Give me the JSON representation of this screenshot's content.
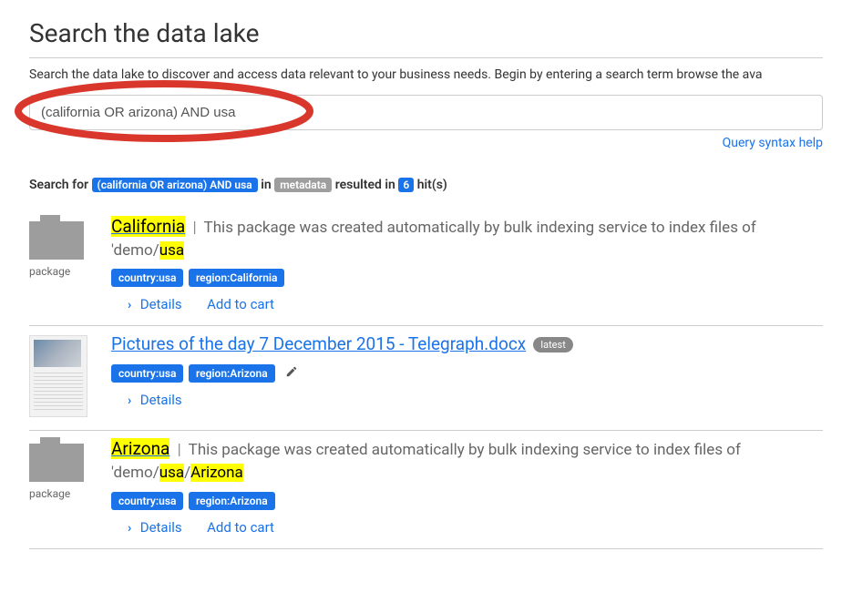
{
  "page": {
    "title": "Search the data lake",
    "subtitle": "Search the data lake to discover and access data relevant to your business needs. Begin by entering a search term browse the ava"
  },
  "search": {
    "value": "(california OR arizona) AND usa",
    "help_label": "Query syntax help"
  },
  "summary": {
    "prefix": "Search for",
    "query": "(california OR arizona) AND usa",
    "in_word": "in",
    "scope": "metadata",
    "result_word": "resulted in",
    "count": "6",
    "suffix": "hit(s)"
  },
  "results": [
    {
      "kind": "package",
      "thumb_caption": "package",
      "title_hl": "California",
      "desc_prefix": "This package was created automatically by bulk indexing service to index files of 'demo/",
      "desc_hl1": "usa",
      "tags": [
        "country:usa",
        "region:California"
      ],
      "has_pencil": false,
      "actions": [
        "Details",
        "Add to cart"
      ]
    },
    {
      "kind": "doc",
      "thumb_caption": "",
      "title": "Pictures of the day 7 December 2015 - Telegraph.docx",
      "version_badge": "latest",
      "tags": [
        "country:usa",
        "region:Arizona"
      ],
      "has_pencil": true,
      "actions": [
        "Details"
      ]
    },
    {
      "kind": "package",
      "thumb_caption": "package",
      "title_hl": "Arizona",
      "desc_prefix": "This package was created automatically by bulk indexing service to index files of 'demo/",
      "desc_hl1": "usa",
      "desc_mid": "/",
      "desc_hl2": "Arizona",
      "tags": [
        "country:usa",
        "region:Arizona"
      ],
      "has_pencil": false,
      "actions": [
        "Details",
        "Add to cart"
      ]
    }
  ]
}
